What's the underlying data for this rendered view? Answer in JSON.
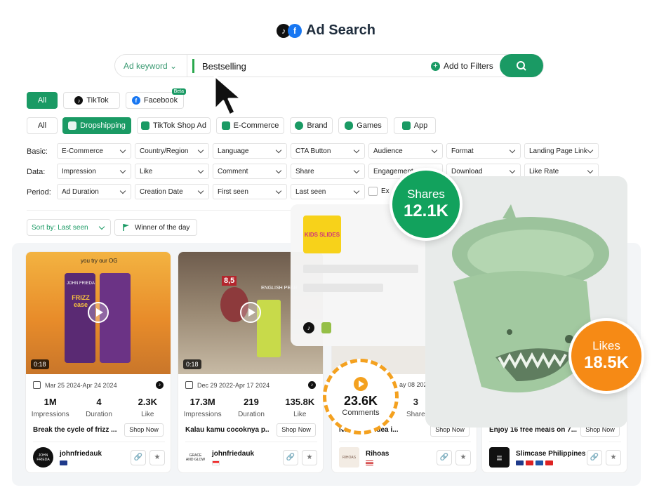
{
  "header": {
    "title": "Ad Search"
  },
  "search": {
    "keyword_type": "Ad keyword",
    "value": "Bestselling",
    "add_filters": "Add to Filters"
  },
  "platform_tabs": [
    {
      "label": "All"
    },
    {
      "label": "TikTok"
    },
    {
      "label": "Facebook",
      "badge": "Beta"
    }
  ],
  "category_tabs": [
    {
      "label": "All"
    },
    {
      "label": "Dropshipping"
    },
    {
      "label": "TikTok Shop Ad"
    },
    {
      "label": "E-Commerce"
    },
    {
      "label": "Brand"
    },
    {
      "label": "Games"
    },
    {
      "label": "App"
    }
  ],
  "filters": {
    "basic_label": "Basic:",
    "data_label": "Data:",
    "period_label": "Period:",
    "basic": [
      "E-Commerce",
      "Country/Region",
      "Language",
      "CTA Button",
      "Audience",
      "Format",
      "Landing Page Link"
    ],
    "data": [
      "Impression",
      "Like",
      "Comment",
      "Share",
      "Engagement",
      "Download",
      "Like Rate"
    ],
    "period": [
      "Ad Duration",
      "Creation Date",
      "First seen",
      "Last seen"
    ],
    "checkbox_label": "Ex"
  },
  "sort": {
    "label": "Sort by: Last seen",
    "winner": "Winner of the day"
  },
  "cards": [
    {
      "duration": "0:18",
      "date": "Mar 25 2024-Apr 24 2024",
      "stats": [
        {
          "value": "1M",
          "label": "Impressions"
        },
        {
          "value": "4",
          "label": "Duration"
        },
        {
          "value": "2.3K",
          "label": "Like"
        }
      ],
      "title": "Break the cycle of frizz ...",
      "shop": "Shop Now",
      "advertiser": "johnfriedauk",
      "avatar_text": "JOHN FRIEDA",
      "thumb_top": "you try our OG",
      "brand": "JOHN FRIEDA",
      "product": "FRIZZ ease"
    },
    {
      "duration": "0:18",
      "date": "Dec 29 2022-Apr 17 2024",
      "stats": [
        {
          "value": "17.3M",
          "label": "Impressions"
        },
        {
          "value": "219",
          "label": "Duration"
        },
        {
          "value": "135.8K",
          "label": "Like"
        }
      ],
      "title": "Kalau kamu cocoknya p...",
      "shop": "Shop Now",
      "advertiser": "johnfriedauk",
      "avatar_text": "GRACE AND GLOW",
      "thumb_top": "ENGLISH PEAR",
      "price": "8,5"
    },
    {
      "date": "ay 08 202",
      "stats": [
        {
          "value": "3",
          "label": "Share"
        }
      ],
      "title": "Ne... Style idea i...",
      "shop": "Shop Now",
      "advertiser": "Rihoas",
      "avatar_text": "RIHOAS"
    },
    {
      "title": "Enjoy 16 free meals on 7...",
      "shop": "Shop Now",
      "advertiser": "Slimcase Philippines"
    }
  ],
  "overlay": {
    "logo_text": "KIDS SLIDES"
  },
  "bubbles": {
    "shares": {
      "label": "Shares",
      "value": "12.1K"
    },
    "likes": {
      "label": "Likes",
      "value": "18.5K"
    },
    "comments": {
      "label": "Comments",
      "value": "23.6K"
    }
  },
  "colors": {
    "accent": "#1a9a64",
    "orange": "#f4a11f",
    "likes": "#f68a15"
  }
}
